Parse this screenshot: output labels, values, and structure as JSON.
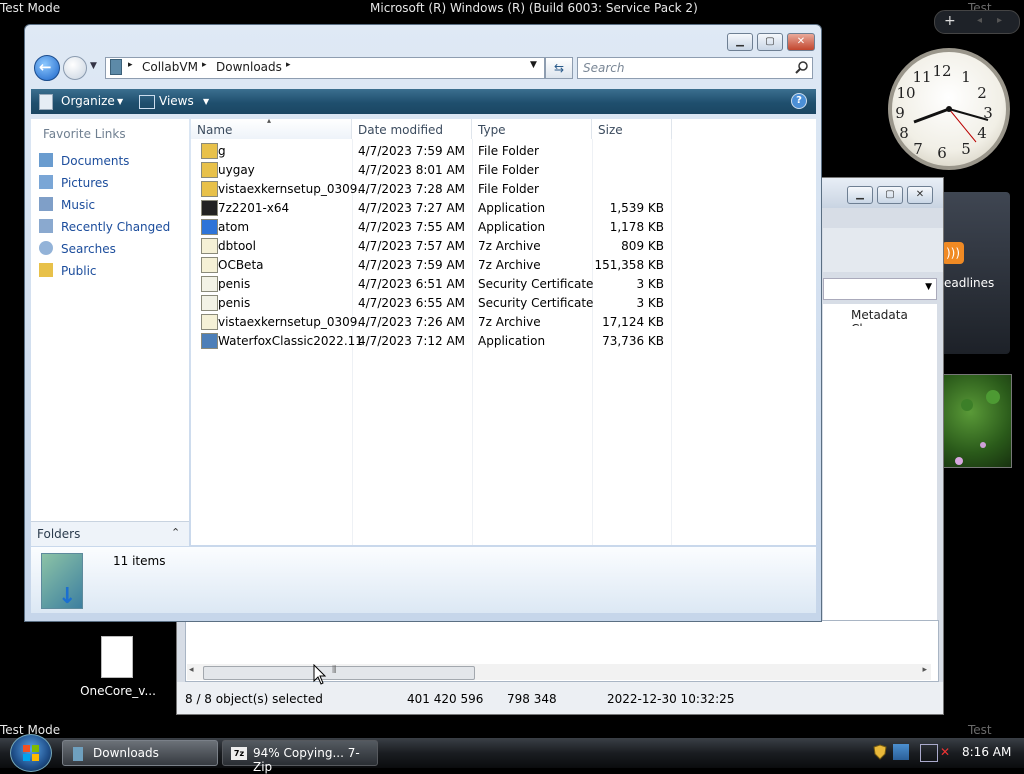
{
  "watermarks": {
    "test_mode_top_left": "Test Mode",
    "title_top": "Microsoft (R) Windows (R) (Build 6003: Service Pack 2)",
    "test_mode_top_right": "Test Mode",
    "test_mode_bottom_left": "Test Mode",
    "test_mode_bottom_right": "Test Mode"
  },
  "explorer": {
    "breadcrumb": [
      "CollabVM",
      "Downloads"
    ],
    "search_placeholder": "Search",
    "toolbar": {
      "organize": "Organize",
      "views": "Views"
    },
    "nav": {
      "header": "Favorite Links",
      "items": [
        "Documents",
        "Pictures",
        "Music",
        "Recently Changed",
        "Searches",
        "Public"
      ],
      "folders_label": "Folders"
    },
    "columns": [
      "Name",
      "Date modified",
      "Type",
      "Size"
    ],
    "files": [
      {
        "name": "g",
        "date": "4/7/2023 7:59 AM",
        "type": "File Folder",
        "size": "",
        "icon": "folder-icon"
      },
      {
        "name": "uygay",
        "date": "4/7/2023 8:01 AM",
        "type": "File Folder",
        "size": "",
        "icon": "folder-icon"
      },
      {
        "name": "vistaexkernsetup_0309...",
        "date": "4/7/2023 7:28 AM",
        "type": "File Folder",
        "size": "",
        "icon": "folder-icon"
      },
      {
        "name": "7z2201-x64",
        "date": "4/7/2023 7:27 AM",
        "type": "Application",
        "size": "1,539 KB",
        "icon": "7zip-icon"
      },
      {
        "name": "atom",
        "date": "4/7/2023 7:55 AM",
        "type": "Application",
        "size": "1,178 KB",
        "icon": "app-icon"
      },
      {
        "name": "dbtool",
        "date": "4/7/2023 7:57 AM",
        "type": "7z Archive",
        "size": "809 KB",
        "icon": "archive-icon"
      },
      {
        "name": "OCBeta",
        "date": "4/7/2023 7:59 AM",
        "type": "7z Archive",
        "size": "151,358 KB",
        "icon": "archive-icon"
      },
      {
        "name": "penis",
        "date": "4/7/2023 6:51 AM",
        "type": "Security Certificate",
        "size": "3 KB",
        "icon": "certificate-icon"
      },
      {
        "name": "penis",
        "date": "4/7/2023 6:55 AM",
        "type": "Security Certificate",
        "size": "3 KB",
        "icon": "certificate-icon"
      },
      {
        "name": "vistaexkernsetup_0309...",
        "date": "4/7/2023 7:26 AM",
        "type": "7z Archive",
        "size": "17,124 KB",
        "icon": "archive-icon"
      },
      {
        "name": "WaterfoxClassic2022.11",
        "date": "4/7/2023 7:12 AM",
        "type": "Application",
        "size": "73,736 KB",
        "icon": "waterfox-icon"
      }
    ],
    "details": {
      "item_count": "11 items"
    }
  },
  "zip_window": {
    "column_partial": "Metadata Cha...",
    "status": {
      "selected": "8 / 8 object(s) selected",
      "size": "401 420 596",
      "packed": "798 348",
      "modified": "2022-12-30 10:32:25"
    }
  },
  "gadgets": {
    "feed_label": "eadlines",
    "clock_numbers": [
      "12",
      "1",
      "2",
      "3",
      "4",
      "5",
      "6",
      "7",
      "8",
      "9",
      "10",
      "11"
    ]
  },
  "desktop": {
    "icon_label": "OneCore_v..."
  },
  "taskbar": {
    "tasks": [
      "Downloads",
      "94% Copying... 7-Zip"
    ],
    "time": "8:16 AM"
  },
  "colors": {
    "accent_toolbar": "#1f4f6e",
    "link_blue": "#1c4d9c",
    "folder_yellow": "#e8c14a"
  }
}
